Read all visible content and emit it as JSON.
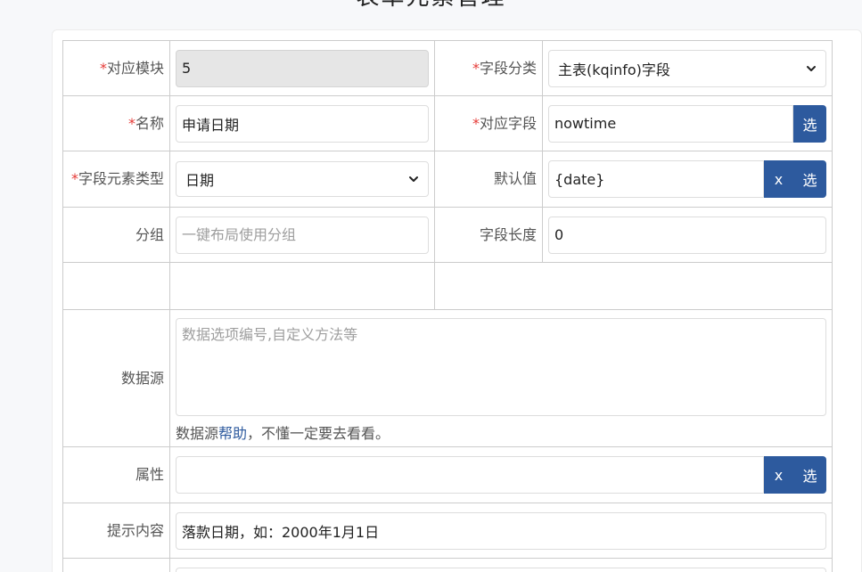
{
  "page_title": "表单元素管理",
  "required_mark": "*",
  "fields": {
    "module": {
      "label": "对应模块",
      "value": "5"
    },
    "category": {
      "label": "字段分类",
      "value": "主表(kqinfo)字段"
    },
    "name": {
      "label": "名称",
      "value": "申请日期"
    },
    "field": {
      "label": "对应字段",
      "value": "nowtime",
      "select_label": "选"
    },
    "element_type": {
      "label": "字段元素类型",
      "value": "日期"
    },
    "default_value": {
      "label": "默认值",
      "value": "{date}",
      "clear_label": "x",
      "select_label": "选"
    },
    "group": {
      "label": "分组",
      "placeholder": "一键布局使用分组"
    },
    "length": {
      "label": "字段长度",
      "value": "0"
    },
    "datasource": {
      "label": "数据源",
      "placeholder": "数据选项编号,自定义方法等",
      "help_prefix": "数据源",
      "help_link": "帮助",
      "help_suffix": "，不懂一定要去看看。"
    },
    "attribute": {
      "label": "属性",
      "value": "",
      "clear_label": "x",
      "select_label": "选"
    },
    "tip": {
      "label": "提示内容",
      "value": "落款日期，如：2000年1月1日"
    }
  },
  "colors": {
    "accent": "#2d5a9e",
    "required": "#e53935"
  }
}
